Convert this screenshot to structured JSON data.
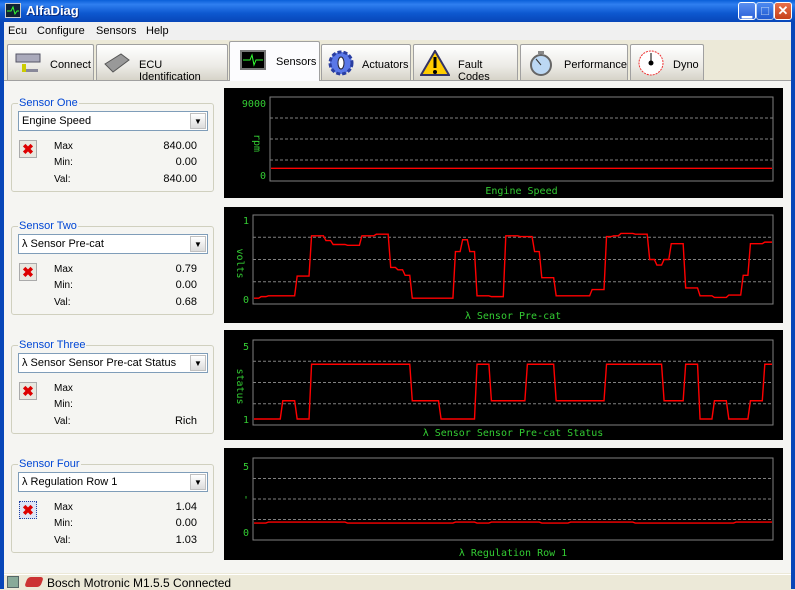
{
  "window": {
    "title": "AlfaDiag",
    "minimize_icon": "minimize-icon",
    "maximize_icon": "maximize-icon",
    "close_icon": "close-icon"
  },
  "menu": [
    "Ecu",
    "Configure",
    "Sensors",
    "Help"
  ],
  "tabs": [
    {
      "label": "Connect",
      "icon": "connect-drive-icon"
    },
    {
      "label": "ECU Identification",
      "icon": "chip-icon"
    },
    {
      "label": "Sensors",
      "icon": "oscilloscope-icon",
      "selected": true
    },
    {
      "label": "Actuators",
      "icon": "gear-icon"
    },
    {
      "label": "Fault Codes",
      "icon": "warning-icon"
    },
    {
      "label": "Performance",
      "icon": "stopwatch-icon"
    },
    {
      "label": "Dyno",
      "icon": "gauge-icon"
    }
  ],
  "sensors": [
    {
      "group": "Sensor One",
      "selected": "Engine Speed",
      "max_label": "Max",
      "min_label": "Min:",
      "val_label": "Val:",
      "max": "840.00",
      "min": "0.00",
      "val": "840.00"
    },
    {
      "group": "Sensor Two",
      "selected": "λ Sensor Pre-cat",
      "max_label": "Max",
      "min_label": "Min:",
      "val_label": "Val:",
      "max": "0.79",
      "min": "0.00",
      "val": "0.68"
    },
    {
      "group": "Sensor Three",
      "selected": "λ Sensor Sensor Pre-cat Status",
      "max_label": "Max",
      "min_label": "Min:",
      "val_label": "Val:",
      "max": "",
      "min": "",
      "val": "Rich"
    },
    {
      "group": "Sensor Four",
      "selected": "λ Regulation Row 1",
      "max_label": "Max",
      "min_label": "Min:",
      "val_label": "Val:",
      "max": "1.04",
      "min": "0.00",
      "val": "1.03"
    }
  ],
  "colors": {
    "line": "#ff0000",
    "text": "#33cc33",
    "grid": "#808080",
    "background": "#000000"
  },
  "chart_data": [
    {
      "type": "line",
      "title": "Engine Speed",
      "ylabel": "rpm",
      "ylim": [
        0,
        9000
      ],
      "yticks": [
        "9000",
        "0"
      ],
      "grid": true,
      "values": [
        840,
        840,
        840,
        840,
        840,
        840,
        840,
        840,
        840,
        840,
        840,
        840,
        840,
        840,
        840,
        840,
        840,
        840,
        840,
        840,
        840,
        840,
        840,
        840,
        840,
        840,
        840,
        840,
        840,
        840,
        840,
        840,
        840,
        840,
        840,
        840,
        840,
        840,
        840,
        840,
        840,
        840,
        840,
        840,
        840,
        840,
        840,
        840,
        840,
        840,
        840,
        840,
        840,
        840,
        840,
        840,
        840,
        840,
        840,
        840,
        840,
        840,
        840,
        840,
        840,
        840,
        840,
        840,
        840,
        840,
        840,
        840,
        840
      ]
    },
    {
      "type": "line",
      "title": "λ Sensor Pre-cat",
      "ylabel": "volts",
      "ylim": [
        0,
        1
      ],
      "yticks": [
        "1",
        "0"
      ],
      "grid": true,
      "values": [
        0.01,
        0.03,
        0.04,
        0.04,
        0.04,
        0.04,
        0.29,
        0.29,
        0.8,
        0.8,
        0.74,
        0.69,
        0.69,
        0.68,
        0.68,
        0.8,
        0.8,
        0.82,
        0.82,
        0.4,
        0.37,
        0.3,
        0.01,
        0.01,
        0.01,
        0.01,
        0.01,
        0.01,
        0.6,
        0.75,
        0.6,
        0.04,
        0.04,
        0.03,
        0.03,
        0.8,
        0.8,
        0.79,
        0.79,
        0.6,
        0.27,
        0.27,
        0.04,
        0.04,
        0.04,
        0.04,
        0.04,
        0.12,
        0.12,
        0.79,
        0.8,
        0.83,
        0.83,
        0.82,
        0.82,
        0.5,
        0.43,
        0.5,
        0.7,
        0.7,
        0.14,
        0.14,
        0.04,
        0.04,
        0.02,
        0.02,
        0.05,
        0.05,
        0.3,
        0.7,
        0.7,
        0.72,
        0.72
      ]
    },
    {
      "type": "line",
      "title": "λ Sensor Sensor Pre-cat Status",
      "ylabel": "status",
      "ylim": [
        1,
        5
      ],
      "yticks": [
        "5",
        "1"
      ],
      "grid": true,
      "values": [
        1,
        1,
        1,
        1,
        2,
        2,
        1,
        1,
        4,
        4,
        4,
        4,
        4,
        4,
        4,
        4,
        4,
        4,
        4,
        4,
        4,
        4,
        2,
        2,
        2,
        2,
        1,
        1,
        1,
        1,
        1,
        4,
        4,
        2,
        2,
        2,
        2,
        2,
        4,
        4,
        4,
        4,
        2,
        2,
        2,
        2,
        2,
        2,
        2,
        4,
        4,
        4,
        4,
        4,
        4,
        4,
        4,
        2,
        2,
        2,
        4,
        4,
        1,
        1,
        2,
        2,
        1,
        1,
        1,
        2,
        2,
        4,
        4
      ]
    },
    {
      "type": "line",
      "title": "λ Regulation Row 1",
      "ylabel": "",
      "ylim": [
        0,
        5
      ],
      "yticks": [
        "5",
        "'",
        "0"
      ],
      "grid": true,
      "values": [
        0.68,
        0.68,
        0.75,
        0.75,
        0.75,
        0.75,
        0.75,
        0.75,
        0.75,
        0.75,
        0.75,
        0.75,
        0.75,
        0.68,
        0.68,
        0.68,
        0.68,
        0.68,
        0.68,
        0.68,
        0.68,
        0.68,
        0.68,
        0.68,
        0.68,
        0.68,
        0.68,
        0.68,
        0.75,
        0.75,
        0.75,
        0.68,
        0.68,
        0.75,
        0.75,
        0.75,
        0.75,
        0.75,
        0.75,
        0.75,
        0.68,
        0.68,
        0.68,
        0.68,
        0.75,
        0.75,
        0.75,
        0.75,
        0.75,
        0.75,
        0.75,
        0.75,
        0.75,
        0.68,
        0.68,
        0.68,
        0.68,
        0.68,
        0.68,
        0.68,
        0.68,
        0.68,
        0.68,
        0.68,
        0.68,
        0.68,
        0.68,
        0.75,
        0.75,
        0.75,
        0.75,
        0.75,
        0.75
      ]
    }
  ],
  "statusbar": {
    "text": "Bosch Motronic M1.5.5 Connected",
    "icons": [
      "network-icon",
      "ecu-connector-icon"
    ]
  }
}
